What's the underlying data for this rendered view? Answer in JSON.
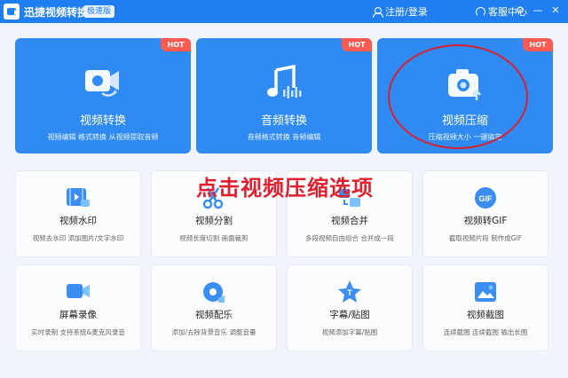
{
  "titlebar": {
    "app_title": "迅捷视频转换器",
    "edition": "极速版",
    "login": "注册/登录",
    "service": "客服中心",
    "settings_glyph": "⚙",
    "minimize_glyph": "—",
    "close_glyph": "✕"
  },
  "colors": {
    "titlebar": "#1f7ef0",
    "card_blue": "#2f8bf2",
    "hot_badge": "#ff5a51",
    "annotation_red": "#e0202c"
  },
  "feature_cards": [
    {
      "title": "视频转换",
      "desc": "视频编辑 格式转换 从视频提取音频",
      "badge": "HOT",
      "icon": "video-convert-icon"
    },
    {
      "title": "音频转换",
      "desc": "音频格式转换 音频编辑",
      "badge": "HOT",
      "icon": "music-note-icon"
    },
    {
      "title": "视频压缩",
      "desc": "压缩视频大小 一键搞定",
      "badge": "HOT",
      "icon": "camera-compress-icon"
    }
  ],
  "tool_cards": [
    {
      "title": "视频水印",
      "desc": "视频去水印 添加图片/文字水印",
      "icon": "film-watermark-icon"
    },
    {
      "title": "视频分割",
      "desc": "视频长度切割 画面裁剪",
      "icon": "scissors-icon"
    },
    {
      "title": "视频合并",
      "desc": "多段视频自由组合 合并成一段",
      "icon": "merge-icon"
    },
    {
      "title": "视频转GIF",
      "desc": "截取视频片段 制作成GIF",
      "icon": "gif-icon"
    },
    {
      "title": "屏幕录像",
      "desc": "实时录制 支持系统&麦克风录音",
      "icon": "screen-record-icon"
    },
    {
      "title": "视频配乐",
      "desc": "添加/去除背景音乐 调整音量",
      "icon": "music-disc-icon"
    },
    {
      "title": "字幕/贴图",
      "desc": "视频添加字幕/贴图",
      "icon": "subtitle-star-icon"
    },
    {
      "title": "视频截图",
      "desc": "连续截图 连续截图 输出长图",
      "icon": "screenshot-icon"
    }
  ],
  "annotation": {
    "caption": "点击视频压缩选项"
  }
}
